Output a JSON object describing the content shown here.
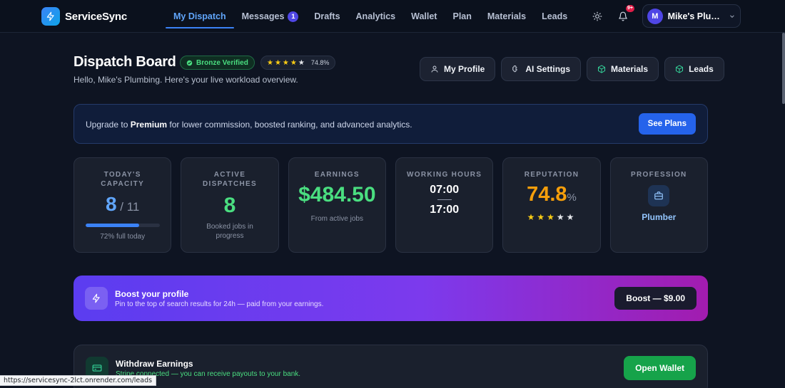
{
  "brand": {
    "name": "ServiceSync"
  },
  "nav": {
    "links": [
      "My Dispatch",
      "Messages",
      "Drafts",
      "Analytics",
      "Wallet",
      "Plan",
      "Materials",
      "Leads"
    ],
    "messages_badge": "1",
    "notifications_badge": "9+",
    "user_initial": "M",
    "user_name": "Mike's Plumbing"
  },
  "header": {
    "title": "Dispatch Board",
    "verified_label": "Bronze Verified",
    "rating_value": "74.8%",
    "rating_stars_filled": 4,
    "subtitle": "Hello, Mike's Plumbing. Here's your live workload overview.",
    "actions": [
      "My Profile",
      "AI Settings",
      "Materials",
      "Leads"
    ]
  },
  "upgrade": {
    "text_prefix": "Upgrade to",
    "plan": "Premium",
    "text_suffix": "for lower commission, boosted ranking, and advanced analytics.",
    "button": "See Plans"
  },
  "stats": {
    "capacity": {
      "label": "TODAY'S CAPACITY",
      "value": "8",
      "total": "11",
      "fill_fraction": 0.72,
      "note": "72% full today"
    },
    "active": {
      "label": "ACTIVE DISPATCHES",
      "value": "8",
      "note": "Booked jobs in progress"
    },
    "earnings": {
      "label": "EARNINGS",
      "value": "$484.50",
      "note": "From active jobs"
    },
    "hours": {
      "label": "WORKING HOURS",
      "start": "07:00",
      "end": "17:00"
    },
    "reputation": {
      "label": "REPUTATION",
      "value": "74.8",
      "unit": "%",
      "stars_filled": 3
    },
    "profession": {
      "label": "PROFESSION",
      "value": "Plumber"
    }
  },
  "boost": {
    "title": "Boost your profile",
    "subtitle": "Pin to the top of search results for 24h — paid from your earnings.",
    "button": "Boost — $9.00"
  },
  "withdraw": {
    "title": "Withdraw Earnings",
    "subtitle": "Stripe connected — you can receive payouts to your bank.",
    "button": "Open Wallet"
  },
  "status_url": "https://servicesync-2lct.onrender.com/leads"
}
